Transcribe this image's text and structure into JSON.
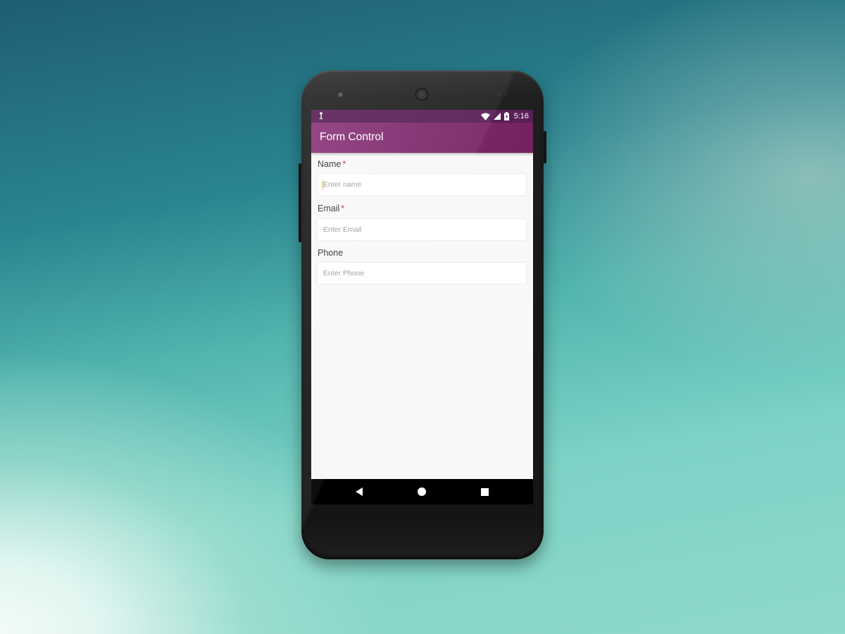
{
  "status_bar": {
    "time": "5:16",
    "icons": [
      "usb-icon",
      "wifi-icon",
      "cell-signal-icon",
      "battery-charging-icon"
    ]
  },
  "app_bar": {
    "title": "Form Control",
    "color": "#7d2a6d"
  },
  "form": {
    "fields": [
      {
        "label": "Name",
        "required_mark": "*",
        "placeholder": "Enter name",
        "value": ""
      },
      {
        "label": "Email",
        "required_mark": "*",
        "placeholder": "Enter Email",
        "value": ""
      },
      {
        "label": "Phone",
        "required_mark": "",
        "placeholder": "Enter Phone",
        "value": ""
      }
    ],
    "required_color": "#d32f2f"
  },
  "nav_bar": {
    "buttons": [
      "back-icon",
      "home-icon",
      "recents-icon"
    ]
  }
}
